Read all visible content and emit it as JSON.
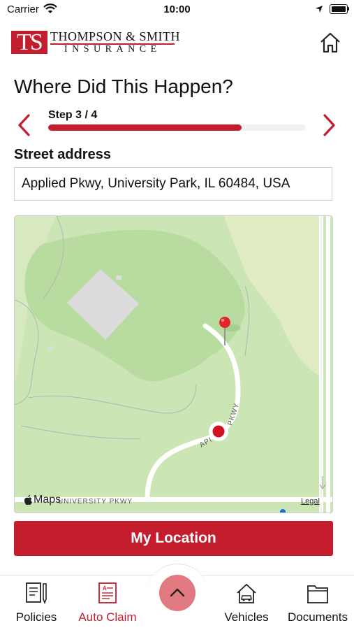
{
  "status_bar": {
    "carrier": "Carrier",
    "time": "10:00"
  },
  "header": {
    "logo_initials": "TS",
    "logo_name": "THOMPSON & SMITH",
    "logo_sub": "INSURANCE",
    "home_icon": "home-icon"
  },
  "page": {
    "title": "Where Did This Happen?"
  },
  "steps": {
    "label": "Step 3 / 4",
    "progress": 0.75
  },
  "street": {
    "label": "Street address",
    "value": "Applied Pkwy, University Park, IL 60484, USA"
  },
  "map": {
    "attribution": "Maps",
    "legal": "Legal",
    "road_labels": [
      "PKWY",
      "API",
      "UNIVERSITY PKWY"
    ]
  },
  "button": {
    "label": "My Location"
  },
  "tabs": [
    {
      "label": "Policies",
      "icon": "policies-icon",
      "active": false
    },
    {
      "label": "Auto Claim",
      "icon": "auto-claim-icon",
      "active": true
    },
    {
      "label": "Vehicles",
      "icon": "vehicles-icon",
      "active": false
    },
    {
      "label": "Documents",
      "icon": "documents-icon",
      "active": false
    }
  ],
  "colors": {
    "brand": "#c41e2e",
    "map_green": "#cbe6b4",
    "park_green": "#b8dc9f"
  }
}
